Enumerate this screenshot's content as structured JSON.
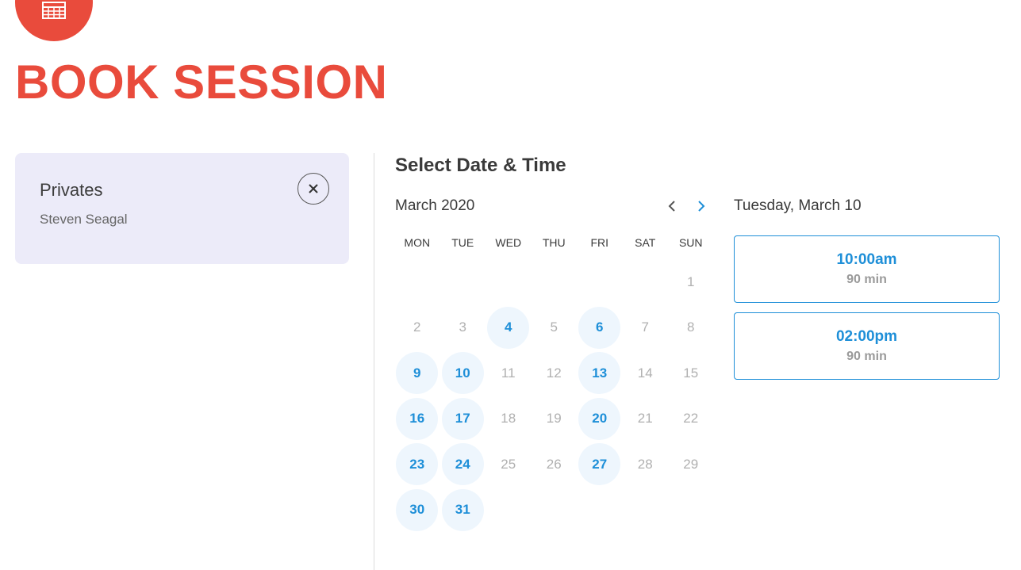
{
  "header": {
    "logo_icon": "calendar-icon",
    "title": "BOOK SESSION",
    "accent_color": "#e94b3c"
  },
  "service": {
    "name": "Privates",
    "staff": "Steven Seagal",
    "clear_icon": "close-icon"
  },
  "scheduler": {
    "title": "Select Date & Time",
    "month_label": "March 2020",
    "prev_icon": "chevron-left-icon",
    "next_icon": "chevron-right-icon",
    "weekdays": [
      "MON",
      "TUE",
      "WED",
      "THU",
      "FRI",
      "SAT",
      "SUN"
    ],
    "leading_blanks": 6,
    "days": [
      {
        "d": "1",
        "available": false
      },
      {
        "d": "2",
        "available": false
      },
      {
        "d": "3",
        "available": false
      },
      {
        "d": "4",
        "available": true
      },
      {
        "d": "5",
        "available": false
      },
      {
        "d": "6",
        "available": true
      },
      {
        "d": "7",
        "available": false
      },
      {
        "d": "8",
        "available": false
      },
      {
        "d": "9",
        "available": true
      },
      {
        "d": "10",
        "available": true
      },
      {
        "d": "11",
        "available": false
      },
      {
        "d": "12",
        "available": false
      },
      {
        "d": "13",
        "available": true
      },
      {
        "d": "14",
        "available": false
      },
      {
        "d": "15",
        "available": false
      },
      {
        "d": "16",
        "available": true
      },
      {
        "d": "17",
        "available": true
      },
      {
        "d": "18",
        "available": false
      },
      {
        "d": "19",
        "available": false
      },
      {
        "d": "20",
        "available": true
      },
      {
        "d": "21",
        "available": false
      },
      {
        "d": "22",
        "available": false
      },
      {
        "d": "23",
        "available": true
      },
      {
        "d": "24",
        "available": true
      },
      {
        "d": "25",
        "available": false
      },
      {
        "d": "26",
        "available": false
      },
      {
        "d": "27",
        "available": true
      },
      {
        "d": "28",
        "available": false
      },
      {
        "d": "29",
        "available": false
      },
      {
        "d": "30",
        "available": true
      },
      {
        "d": "31",
        "available": true
      }
    ],
    "selected_date_label": "Tuesday, March 10",
    "slots": [
      {
        "time": "10:00am",
        "duration": "90 min"
      },
      {
        "time": "02:00pm",
        "duration": "90 min"
      }
    ],
    "available_color": "#1e8fd8"
  }
}
